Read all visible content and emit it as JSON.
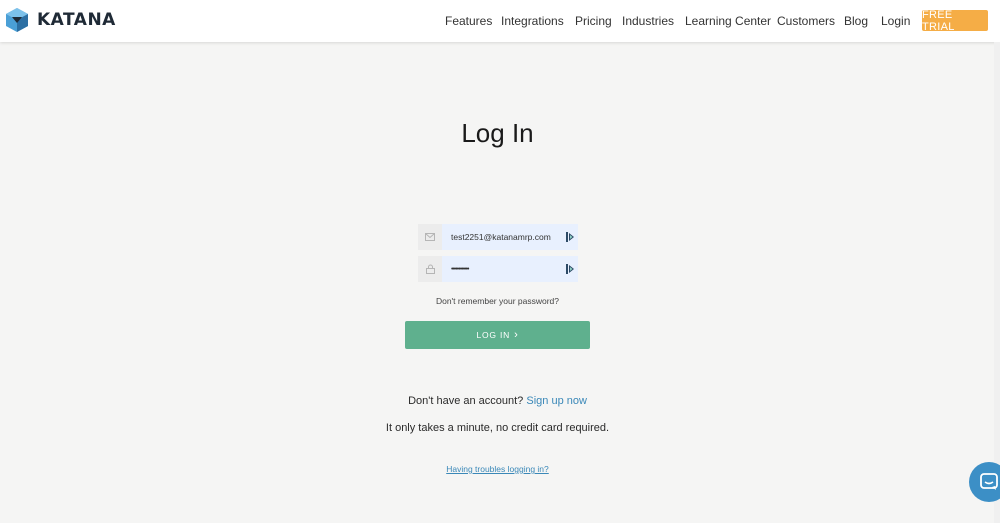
{
  "header": {
    "brand": "KATANA",
    "nav": [
      "Features",
      "Integrations",
      "Pricing",
      "Industries",
      "Learning Center",
      "Customers",
      "Blog",
      "Login"
    ],
    "cta": "FREE TRIAL"
  },
  "login": {
    "title": "Log In",
    "email_value": "test2251@katanamrp.com",
    "password_value": "••••••••••••",
    "forgot": "Don't remember your password?",
    "submit": "LOG IN",
    "submit_chevron": "›"
  },
  "signup": {
    "prompt": "Don't have an account?",
    "link": "Sign up now",
    "note": "It only takes a minute, no credit card required."
  },
  "help": {
    "trouble": "Having troubles logging in?"
  },
  "colors": {
    "accent_green": "#5fb08e",
    "trial_orange": "#f5ad46",
    "link_blue": "#3a88b8",
    "chat_blue": "#3c8fc6"
  },
  "icons": [
    "katana-logo",
    "email-icon",
    "lock-icon",
    "password-manager-icon",
    "chat-icon"
  ]
}
